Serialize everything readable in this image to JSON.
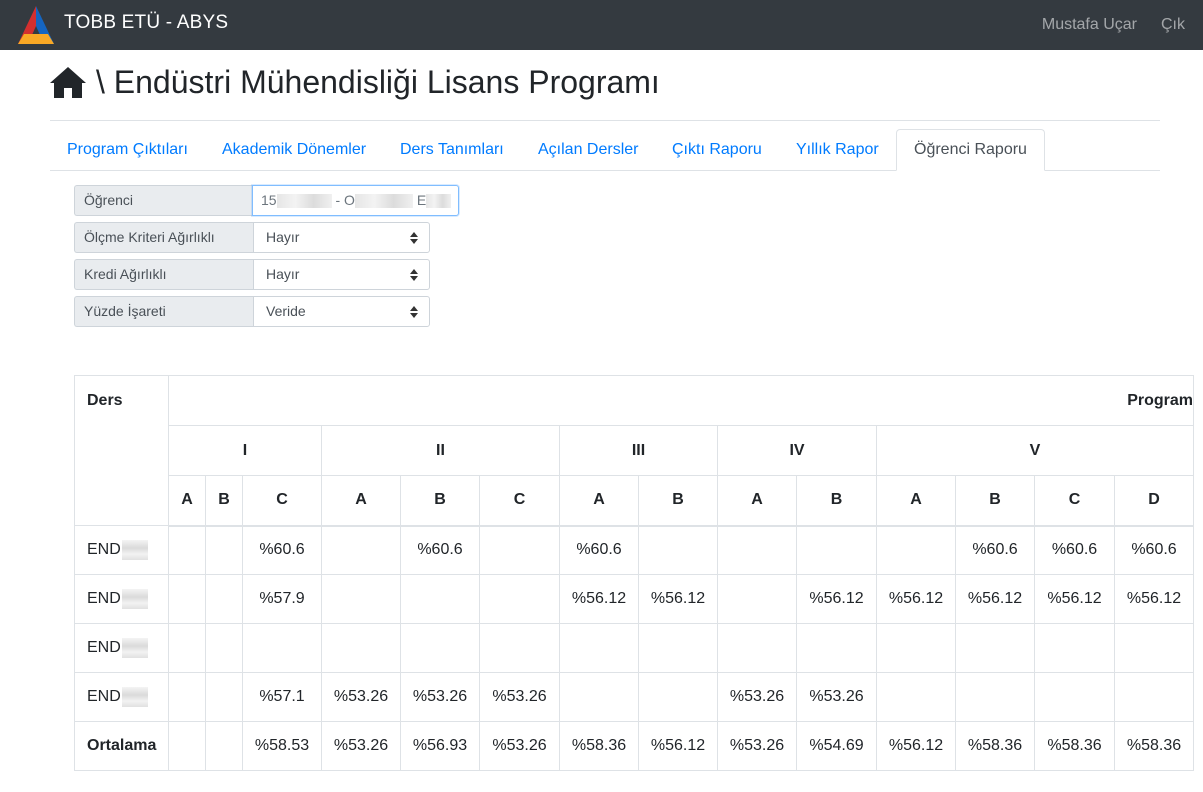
{
  "navbar": {
    "brand": "TOBB ETÜ - ABYS",
    "user": "Mustafa Uçar",
    "logout": "Çık"
  },
  "page": {
    "title": "\\ Endüstri Mühendisliği Lisans Programı"
  },
  "tabs": [
    {
      "label": "Program Çıktıları",
      "active": false
    },
    {
      "label": "Akademik Dönemler",
      "active": false
    },
    {
      "label": "Ders Tanımları",
      "active": false
    },
    {
      "label": "Açılan Dersler",
      "active": false
    },
    {
      "label": "Çıktı Raporu",
      "active": false
    },
    {
      "label": "Yıllık Rapor",
      "active": false
    },
    {
      "label": "Öğrenci Raporu",
      "active": true
    }
  ],
  "form": {
    "student": {
      "label": "Öğrenci",
      "value_prefix": "15",
      "value_mid": "- O",
      "value_end": "E"
    },
    "olcme": {
      "label": "Ölçme Kriteri Ağırlıklı",
      "value": "Hayır"
    },
    "kredi": {
      "label": "Kredi Ağırlıklı",
      "value": "Hayır"
    },
    "yuzde": {
      "label": "Yüzde İşareti",
      "value": "Veride"
    }
  },
  "table": {
    "ders_header": "Ders",
    "program_header": "Program",
    "groups": [
      "I",
      "II",
      "III",
      "IV",
      "V"
    ],
    "subheaders": {
      "I": [
        "A",
        "B",
        "C"
      ],
      "II": [
        "A",
        "B",
        "C"
      ],
      "III": [
        "A",
        "B"
      ],
      "IV": [
        "A",
        "B"
      ],
      "V": [
        "A",
        "B",
        "C",
        "D"
      ]
    },
    "rows": [
      {
        "code": "END",
        "cells": [
          "",
          "",
          "%60.6",
          "",
          "%60.6",
          "",
          "%60.6",
          "",
          "",
          "",
          "",
          "%60.6",
          "%60.6",
          "%60.6"
        ]
      },
      {
        "code": "END",
        "cells": [
          "",
          "",
          "%57.9",
          "",
          "",
          "",
          "%56.12",
          "%56.12",
          "",
          "%56.12",
          "%56.12",
          "%56.12",
          "%56.12",
          "%56.12"
        ]
      },
      {
        "code": "END",
        "cells": [
          "",
          "",
          "",
          "",
          "",
          "",
          "",
          "",
          "",
          "",
          "",
          "",
          "",
          ""
        ]
      },
      {
        "code": "END",
        "cells": [
          "",
          "",
          "%57.1",
          "%53.26",
          "%53.26",
          "%53.26",
          "",
          "",
          "%53.26",
          "%53.26",
          "",
          "",
          "",
          ""
        ]
      }
    ],
    "average": {
      "label": "Ortalama",
      "cells": [
        "",
        "",
        "%58.53",
        "%53.26",
        "%56.93",
        "%53.26",
        "%58.36",
        "%56.12",
        "%53.26",
        "%54.69",
        "%56.12",
        "%58.36",
        "%58.36",
        "%58.36"
      ]
    }
  }
}
